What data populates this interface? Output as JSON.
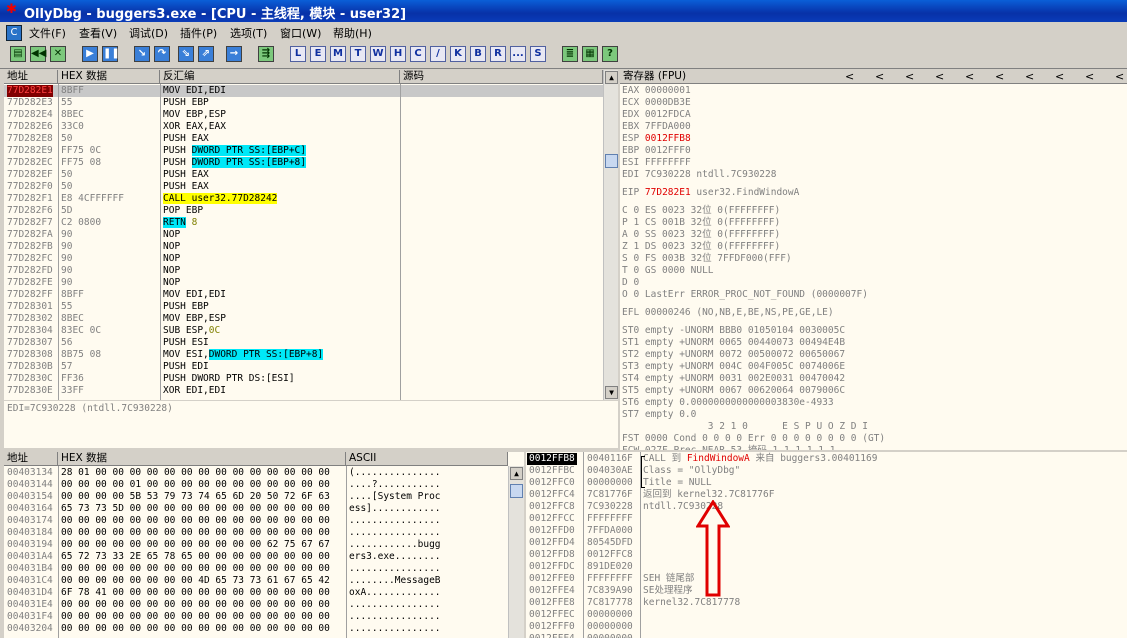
{
  "window": {
    "title": "OllyDbg - buggers3.exe - [CPU - 主线程, 模块 - user32]",
    "logo": "✱",
    "cpu_icon": "C"
  },
  "menu": [
    "文件(F)",
    "查看(V)",
    "调试(D)",
    "插件(P)",
    "选项(T)",
    "窗口(W)",
    "帮助(H)"
  ],
  "toolbar": {
    "letters": [
      "L",
      "E",
      "M",
      "T",
      "W",
      "H",
      "C",
      "/",
      "K",
      "B",
      "R",
      "...",
      "S"
    ]
  },
  "disasm": {
    "headers": [
      "地址",
      "HEX 数据",
      "反汇编",
      "源码"
    ],
    "rows": [
      {
        "addr": "77D282E1",
        "hex": "8BFF",
        "asm": "MOV EDI,EDI"
      },
      {
        "addr": "77D282E3",
        "hex": "55",
        "asm": "PUSH EBP"
      },
      {
        "addr": "77D282E4",
        "hex": "8BEC",
        "asm": "MOV EBP,ESP"
      },
      {
        "addr": "77D282E6",
        "hex": "33C0",
        "asm": "XOR EAX,EAX"
      },
      {
        "addr": "77D282E8",
        "hex": "50",
        "asm": "PUSH EAX"
      },
      {
        "addr": "77D282E9",
        "hex": "FF75 0C",
        "asm_pre": "PUSH ",
        "asm_hl": "DWORD PTR SS:[EBP+C]"
      },
      {
        "addr": "77D282EC",
        "hex": "FF75 08",
        "asm_pre": "PUSH ",
        "asm_hl": "DWORD PTR SS:[EBP+8]"
      },
      {
        "addr": "77D282EF",
        "hex": "50",
        "asm": "PUSH EAX"
      },
      {
        "addr": "77D282F0",
        "hex": "50",
        "asm": "PUSH EAX"
      },
      {
        "addr": "77D282F1",
        "hex": "E8 4CFFFFFF",
        "asm_call": "CALL user32.77D28242"
      },
      {
        "addr": "77D282F6",
        "hex": "5D",
        "asm": "POP EBP"
      },
      {
        "addr": "77D282F7",
        "hex": "C2 0800",
        "asm_retn": "RETN",
        "asm_post": " 8"
      },
      {
        "addr": "77D282FA",
        "hex": "90",
        "asm": "NOP"
      },
      {
        "addr": "77D282FB",
        "hex": "90",
        "asm": "NOP"
      },
      {
        "addr": "77D282FC",
        "hex": "90",
        "asm": "NOP"
      },
      {
        "addr": "77D282FD",
        "hex": "90",
        "asm": "NOP"
      },
      {
        "addr": "77D282FE",
        "hex": "90",
        "asm": "NOP"
      },
      {
        "addr": "77D282FF",
        "hex": "8BFF",
        "asm": "MOV EDI,EDI"
      },
      {
        "addr": "77D28301",
        "hex": "55",
        "asm": "PUSH EBP"
      },
      {
        "addr": "77D28302",
        "hex": "8BEC",
        "asm": "MOV EBP,ESP"
      },
      {
        "addr": "77D28304",
        "hex": "83EC 0C",
        "asm_pre": "SUB ESP,",
        "asm_num": "0C"
      },
      {
        "addr": "77D28307",
        "hex": "56",
        "asm": "PUSH ESI"
      },
      {
        "addr": "77D28308",
        "hex": "8B75 08",
        "asm_pre": "MOV ESI,",
        "asm_hl": "DWORD PTR SS:[EBP+8]"
      },
      {
        "addr": "77D2830B",
        "hex": "57",
        "asm": "PUSH EDI"
      },
      {
        "addr": "77D2830C",
        "hex": "FF36",
        "asm": "PUSH DWORD PTR DS:[ESI]"
      },
      {
        "addr": "77D2830E",
        "hex": "33FF",
        "asm": "XOR EDI,EDI"
      }
    ],
    "info_line": "EDI=7C930228 (ntdll.7C930228)"
  },
  "registers": {
    "header": "寄存器 (FPU)",
    "arrows": "<",
    "gp": [
      {
        "name": "EAX",
        "val": "00000001"
      },
      {
        "name": "ECX",
        "val": "0000DB3E"
      },
      {
        "name": "EDX",
        "val": "0012FDCA"
      },
      {
        "name": "EBX",
        "val": "7FFDA000"
      },
      {
        "name": "ESP",
        "val": "0012FFB8",
        "red": true
      },
      {
        "name": "EBP",
        "val": "0012FFF0"
      },
      {
        "name": "ESI",
        "val": "FFFFFFFF"
      },
      {
        "name": "EDI",
        "val": "7C930228",
        "extra": " ntdll.7C930228"
      }
    ],
    "eip": {
      "name": "EIP",
      "val": "77D282E1",
      "extra": " user32.FindWindowA"
    },
    "flags": [
      "C 0   ES 0023 32位 0(FFFFFFFF)",
      "P 1   CS 001B 32位 0(FFFFFFFF)",
      "A 0   SS 0023 32位 0(FFFFFFFF)",
      "Z 1   DS 0023 32位 0(FFFFFFFF)",
      "S 0   FS 003B 32位 7FFDF000(FFF)",
      "T 0   GS 0000 NULL",
      "D 0",
      "O 0   LastErr ERROR_PROC_NOT_FOUND (0000007F)"
    ],
    "efl": "EFL 00000246 (NO,NB,E,BE,NS,PE,GE,LE)",
    "fpu": [
      "ST0 empty -UNORM BBB0 01050104 0030005C",
      "ST1 empty +UNORM 0065 00440073 00494E4B",
      "ST2 empty +UNORM 0072 00500072 00650067",
      "ST3 empty +UNORM 004C 004F005C 0074006E",
      "ST4 empty +UNORM 0031 002E0031 00470042",
      "ST5 empty +UNORM 0067 00620064 0079006C",
      "ST6 empty 0.0000000000000003830e-4933",
      "ST7 empty 0.0"
    ],
    "fpu_bits_header": "               3 2 1 0      E S P U O Z D I",
    "fst": "FST 0000  Cond 0 0 0 0  Err 0 0 0 0 0 0 0 0  (GT)",
    "fcw": "FCW 027F  Prec NEAR,53  掩码    1 1 1 1 1 1"
  },
  "dump": {
    "headers": [
      "地址",
      "HEX 数据",
      "ASCII"
    ],
    "rows": [
      {
        "addr": "00403134",
        "hex": "28 01 00 00 00 00 00 00 00 00 00 00 00 00 00 00",
        "ascii": "(..............."
      },
      {
        "addr": "00403144",
        "hex": "00 00 00 00 01 00 00 00 00 00 00 00 00 00 00 00",
        "ascii": "....?..........."
      },
      {
        "addr": "00403154",
        "hex": "00 00 00 00 5B 53 79 73 74 65 6D 20 50 72 6F 63",
        "ascii": "....[System Proc"
      },
      {
        "addr": "00403164",
        "hex": "65 73 73 5D 00 00 00 00 00 00 00 00 00 00 00 00",
        "ascii": "ess]............"
      },
      {
        "addr": "00403174",
        "hex": "00 00 00 00 00 00 00 00 00 00 00 00 00 00 00 00",
        "ascii": "................"
      },
      {
        "addr": "00403184",
        "hex": "00 00 00 00 00 00 00 00 00 00 00 00 00 00 00 00",
        "ascii": "................"
      },
      {
        "addr": "00403194",
        "hex": "00 00 00 00 00 00 00 00 00 00 00 00 62 75 67 67",
        "ascii": "............bugg"
      },
      {
        "addr": "004031A4",
        "hex": "65 72 73 33 2E 65 78 65 00 00 00 00 00 00 00 00",
        "ascii": "ers3.exe........"
      },
      {
        "addr": "004031B4",
        "hex": "00 00 00 00 00 00 00 00 00 00 00 00 00 00 00 00",
        "ascii": "................"
      },
      {
        "addr": "004031C4",
        "hex": "00 00 00 00 00 00 00 00 4D 65 73 73 61 67 65 42",
        "ascii": "........MessageB"
      },
      {
        "addr": "004031D4",
        "hex": "6F 78 41 00 00 00 00 00 00 00 00 00 00 00 00 00",
        "ascii": "oxA............."
      },
      {
        "addr": "004031E4",
        "hex": "00 00 00 00 00 00 00 00 00 00 00 00 00 00 00 00",
        "ascii": "................"
      },
      {
        "addr": "004031F4",
        "hex": "00 00 00 00 00 00 00 00 00 00 00 00 00 00 00 00",
        "ascii": "................"
      },
      {
        "addr": "00403204",
        "hex": "00 00 00 00 00 00 00 00 00 00 00 00 00 00 00 00",
        "ascii": "................"
      }
    ]
  },
  "stack": {
    "rows": [
      {
        "addr": "0012FFB8",
        "val": "0040116F",
        "pre": "CALL 到 ",
        "fn": "FindWindowA",
        "post": " 来自 buggers3.00401169",
        "selected": true
      },
      {
        "addr": "0012FFBC",
        "val": "004030AE",
        "comment": "Class = \"OllyDbg\""
      },
      {
        "addr": "0012FFC0",
        "val": "00000000",
        "comment": "Title = NULL"
      },
      {
        "addr": "0012FFC4",
        "val": "7C81776F",
        "comment": "返回到 kernel32.7C81776F"
      },
      {
        "addr": "0012FFC8",
        "val": "7C930228",
        "comment": "ntdll.7C930228"
      },
      {
        "addr": "0012FFCC",
        "val": "FFFFFFFF",
        "comment": ""
      },
      {
        "addr": "0012FFD0",
        "val": "7FFDA000",
        "comment": ""
      },
      {
        "addr": "0012FFD4",
        "val": "80545DFD",
        "comment": ""
      },
      {
        "addr": "0012FFD8",
        "val": "0012FFC8",
        "comment": ""
      },
      {
        "addr": "0012FFDC",
        "val": "891DE020",
        "comment": ""
      },
      {
        "addr": "0012FFE0",
        "val": "FFFFFFFF",
        "comment": "SEH 链尾部"
      },
      {
        "addr": "0012FFE4",
        "val": "7C839A90",
        "comment": "SE处理程序"
      },
      {
        "addr": "0012FFE8",
        "val": "7C817778",
        "comment": "kernel32.7C817778"
      },
      {
        "addr": "0012FFEC",
        "val": "00000000",
        "comment": ""
      },
      {
        "addr": "0012FFF0",
        "val": "00000000",
        "comment": ""
      },
      {
        "addr": "0012FFF4",
        "val": "00000000",
        "comment": ""
      }
    ]
  },
  "colors": {
    "annotation_arrow": "#e00000",
    "highlight_cyan": "#00e8f8",
    "highlight_yellow": "#ffff00",
    "pane_bg": "#fffbf0"
  }
}
